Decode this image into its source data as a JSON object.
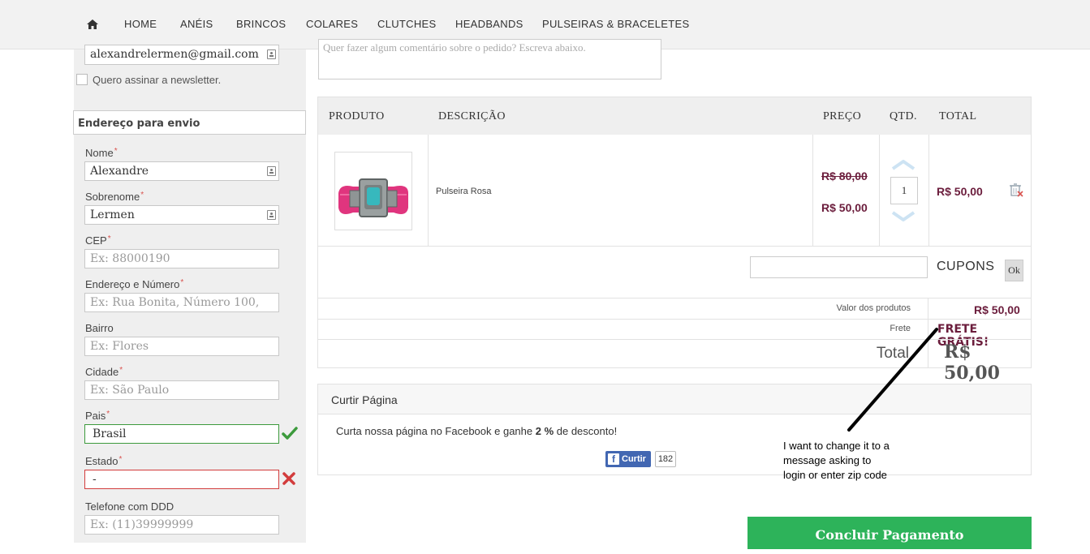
{
  "nav": {
    "home_icon": "home-icon",
    "items": [
      "HOME",
      "ANÉIS",
      "BRINCOS",
      "COLARES",
      "CLUTCHES",
      "HEADBANDS",
      "PULSEIRAS & BRACELETES"
    ]
  },
  "account": {
    "email_value": "alexandrelermen@gmail.com",
    "newsletter_label": "Quero assinar a newsletter."
  },
  "shipping": {
    "section_title": "Endereço para envio",
    "fields": {
      "nome": {
        "label": "Nome",
        "value": "Alexandre"
      },
      "sobrenome": {
        "label": "Sobrenome",
        "value": "Lermen"
      },
      "cep": {
        "label": "CEP",
        "placeholder": "Ex: 88000190"
      },
      "endereco": {
        "label": "Endereço e Número",
        "placeholder": "Ex: Rua Bonita, Número 100,"
      },
      "bairro": {
        "label": "Bairro",
        "placeholder": "Ex: Flores"
      },
      "cidade": {
        "label": "Cidade",
        "placeholder": "Ex: São Paulo"
      },
      "pais": {
        "label": "Pais",
        "value": "Brasil"
      },
      "estado": {
        "label": "Estado",
        "value": "-"
      },
      "telefone": {
        "label": "Telefone com DDD",
        "placeholder": "Ex: (11)39999999"
      }
    }
  },
  "comment": {
    "partial_text": "Quer fazer algum comentário sobre o pedido? Escreva abaixo."
  },
  "cart": {
    "headers": {
      "produto": "PRODUTO",
      "descricao": "DESCRIÇÃO",
      "preco": "PREÇO",
      "qtd": "QTD.",
      "total": "TOTAL"
    },
    "item": {
      "description": "Pulseira Rosa",
      "old_price": "R$ 80,00",
      "price": "R$ 50,00",
      "quantity": "1",
      "total": "R$ 50,00"
    },
    "coupon_label": "CUPONS",
    "coupon_button": "Ok",
    "summary": {
      "subtotal_label": "Valor dos produtos",
      "subtotal_value": "R$ 50,00",
      "frete_label": "Frete",
      "frete_value": "FRETE GRÁTIS!",
      "total_label": "Total",
      "total_value": "R$ 50,00"
    }
  },
  "like": {
    "title": "Curtir Página",
    "text_before": "Curta nossa página no Facebook e ganhe ",
    "discount": "2 %",
    "text_after": " de desconto!",
    "button_label": "Curtir",
    "count": "182"
  },
  "annotation": {
    "line1": "I want to change it to a",
    "line2": "message asking to",
    "line3": "login or enter zip code"
  },
  "pay_button": "Concluir Pagamento",
  "colors": {
    "accent_price": "#6b1d3c",
    "pay_green": "#2db35a",
    "valid": "#3c9a3c",
    "invalid": "#d23c3c"
  }
}
